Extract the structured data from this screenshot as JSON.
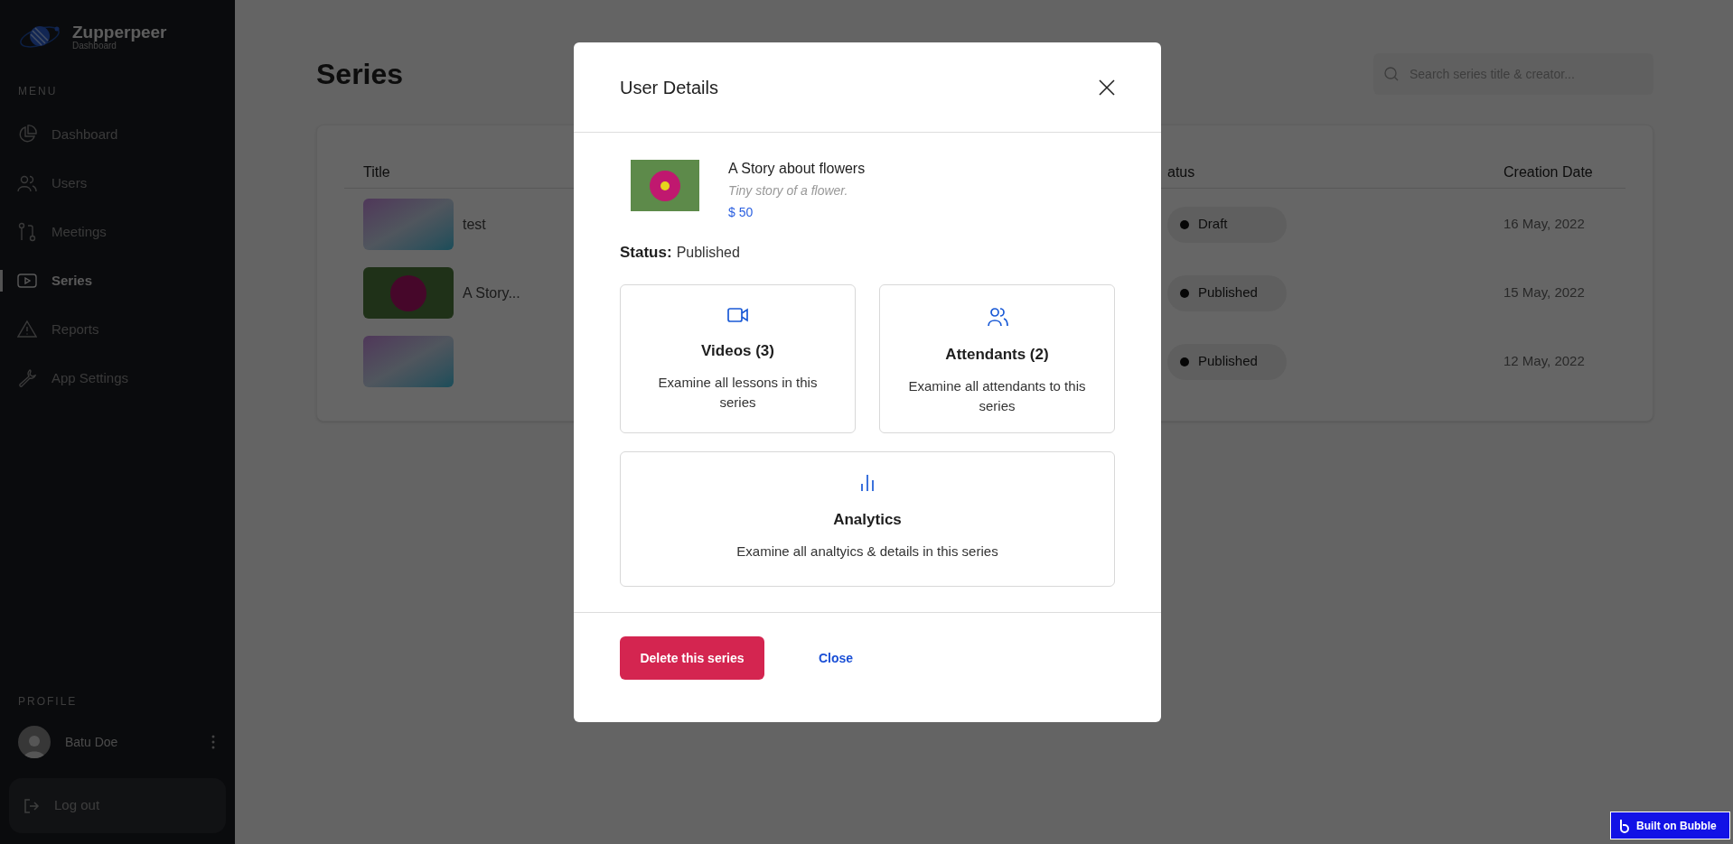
{
  "sidebar": {
    "logo": {
      "name": "Zupperpeer",
      "subtitle": "Dashboard"
    },
    "menu_heading": "MENU",
    "items": [
      {
        "label": "Dashboard",
        "selected": false
      },
      {
        "label": "Users",
        "selected": false
      },
      {
        "label": "Meetings",
        "selected": false
      },
      {
        "label": "Series",
        "selected": true
      },
      {
        "label": "Reports",
        "selected": false
      },
      {
        "label": "App Settings",
        "selected": false
      }
    ],
    "profile_heading": "PROFILE",
    "profile": {
      "name": "Batu Doe"
    },
    "logout": "Log out"
  },
  "page": {
    "title": "Series",
    "search": {
      "placeholder": "Search series title & creator..."
    }
  },
  "table": {
    "columns": [
      "Title",
      "atus",
      "Creation Date"
    ],
    "rows": [
      {
        "kind": "gradient",
        "title": "test",
        "status": "Draft",
        "date": "16 May, 2022"
      },
      {
        "kind": "photo",
        "title": "A Story...",
        "status": "Published",
        "date": "15 May, 2022"
      },
      {
        "kind": "gradient",
        "status": "Published",
        "date": "12 May, 2022"
      }
    ]
  },
  "modal": {
    "title": "User Details",
    "item": {
      "title": "A Story about flowers",
      "description": "Tiny story of a flower.",
      "price": "$ 50"
    },
    "status_label": "Status:",
    "status": "Published",
    "cards": [
      {
        "title": "Videos (3)",
        "description": "Examine all lessons in this series"
      },
      {
        "title": "Attendants (2)",
        "description": "Examine all attendants to this series"
      },
      {
        "title": "Analytics",
        "description": "Examine all analtyics & details in this series"
      }
    ],
    "buttons": {
      "delete": "Delete this series",
      "close": "Close"
    }
  },
  "badge": "Built on Bubble"
}
